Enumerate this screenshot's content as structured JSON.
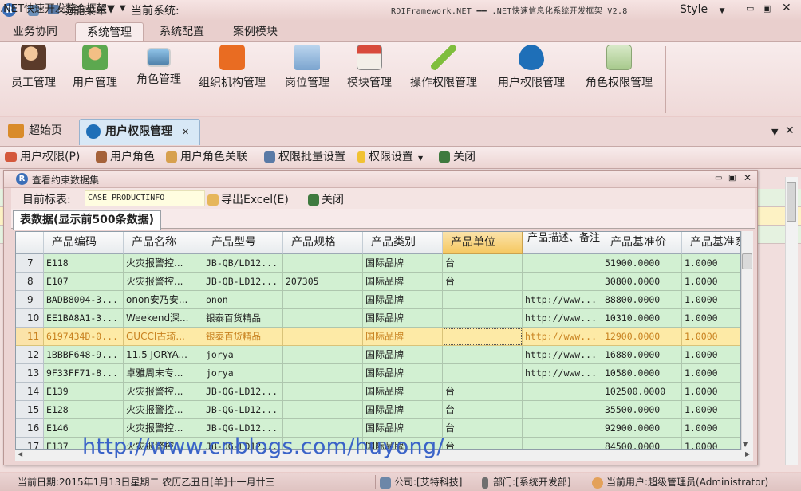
{
  "titlebar": {
    "menu_label": "功能菜单",
    "system_label": "当前系统:",
    "system_value": ".NET快速开发整合框架",
    "app_title": "RDIFramework.NET ━━ .NET快速信息化系统开发框架 V2.8",
    "style_label": "Style"
  },
  "ribbon": {
    "tabs": [
      "业务协同",
      "系统管理",
      "系统配置",
      "案例模块"
    ],
    "buttons": [
      "员工管理",
      "用户管理",
      "角色管理",
      "组织机构管理",
      "岗位管理",
      "模块管理",
      "操作权限管理",
      "用户权限管理",
      "角色权限管理"
    ]
  },
  "doc_tabs": [
    "超始页",
    "用户权限管理"
  ],
  "module_toolbar": [
    "用户权限(P)",
    "用户角色",
    "用户角色关联",
    "权限批量设置",
    "权限设置",
    "关闭"
  ],
  "dialog": {
    "title": "查看约束数据集",
    "target_label": "目前标表:",
    "target_value": "CASE_PRODUCTINFO",
    "export_label": "导出Excel(E)",
    "close_label": "关闭",
    "tab_label": "表数据(显示前500条数据)"
  },
  "grid": {
    "columns": [
      "产品编码",
      "产品名称",
      "产品型号",
      "产品规格",
      "产品类别",
      "产品单位",
      "产品描述、备注",
      "产品基准价",
      "产品基准系"
    ],
    "rows": [
      {
        "no": "7",
        "cells": [
          "E118",
          "火灾报警控...",
          "JB-QB/LD12...",
          "",
          "国际品牌",
          "台",
          "",
          "51900.0000",
          "1.0000"
        ]
      },
      {
        "no": "8",
        "cells": [
          "E107",
          "火灾报警控...",
          "JB-QB-LD12...",
          "207305",
          "国际品牌",
          "台",
          "",
          "30800.0000",
          "1.0000"
        ]
      },
      {
        "no": "9",
        "cells": [
          "BADB8004-3...",
          "onon安乃安...",
          "onon",
          "",
          "国际品牌",
          "",
          "http://www...",
          "88800.0000",
          "1.0000"
        ]
      },
      {
        "no": "10",
        "cells": [
          "EE1BA8A1-3...",
          "Weekend深...",
          "银泰百货精品",
          "",
          "国际品牌",
          "",
          "http://www...",
          "10310.0000",
          "1.0000"
        ]
      },
      {
        "no": "11",
        "cells": [
          "6197434D-0...",
          "GUCCI古琦...",
          "银泰百货精品",
          "",
          "国际品牌",
          "",
          "http://www...",
          "12900.0000",
          "1.0000"
        ]
      },
      {
        "no": "12",
        "cells": [
          "1BBBF648-9...",
          "11.5 JORYA...",
          "jorya",
          "",
          "国际品牌",
          "",
          "http://www...",
          "16880.0000",
          "1.0000"
        ]
      },
      {
        "no": "13",
        "cells": [
          "9F33FF71-8...",
          "卓雅周末专...",
          "jorya",
          "",
          "国际品牌",
          "",
          "http://www...",
          "10580.0000",
          "1.0000"
        ]
      },
      {
        "no": "14",
        "cells": [
          "E139",
          "火灾报警控...",
          "JB-QG-LD12...",
          "",
          "国际品牌",
          "台",
          "",
          "102500.0000",
          "1.0000"
        ]
      },
      {
        "no": "15",
        "cells": [
          "E128",
          "火灾报警控...",
          "JB-QG-LD12...",
          "",
          "国际品牌",
          "台",
          "",
          "35500.0000",
          "1.0000"
        ]
      },
      {
        "no": "16",
        "cells": [
          "E146",
          "火灾报警控...",
          "JB-QG-LD12...",
          "",
          "国际品牌",
          "台",
          "",
          "92900.0000",
          "1.0000"
        ]
      },
      {
        "no": "17",
        "cells": [
          "E137",
          "火灾报警控...",
          "JB-QG-LD12...",
          "",
          "国际品牌",
          "台",
          "",
          "84500.0000",
          "1.0000"
        ]
      }
    ],
    "selected_row": "11"
  },
  "watermark": "http://www.cnblogs.com/huyong/",
  "status": {
    "date": "当前日期:2015年1月13日星期二 农历乙丑日[羊]十一月廿三",
    "company": "公司:[艾特科技]",
    "department": "部门:[系统开发部]",
    "user": "当前用户:超级管理员(Administrator)"
  },
  "colors": {
    "row_green": "#d2f0d2",
    "row_selected": "#fdeaa6",
    "accent_pink": "#e9cbc9"
  }
}
